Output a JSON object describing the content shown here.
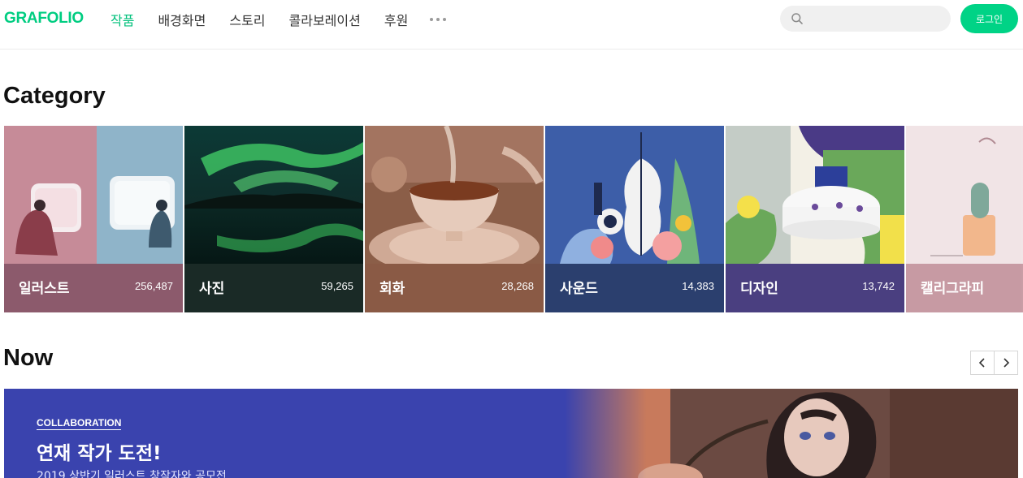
{
  "header": {
    "logo": "GRAFOLIO",
    "nav": [
      {
        "label": "작품",
        "active": true
      },
      {
        "label": "배경화면",
        "active": false
      },
      {
        "label": "스토리",
        "active": false
      },
      {
        "label": "콜라보레이션",
        "active": false
      },
      {
        "label": "후원",
        "active": false
      }
    ],
    "more_icon": "more-dots-icon",
    "search": {
      "placeholder": "",
      "value": "",
      "icon": "search-icon"
    },
    "login_label": "로그인"
  },
  "category": {
    "title": "Category",
    "cards": [
      {
        "name": "일러스트",
        "count": "256,487",
        "bar_color": "#8c5a6c"
      },
      {
        "name": "사진",
        "count": "59,265",
        "bar_color": "#1a2a26"
      },
      {
        "name": "회화",
        "count": "28,268",
        "bar_color": "#8a5a45"
      },
      {
        "name": "사운드",
        "count": "14,383",
        "bar_color": "#2b3f6e"
      },
      {
        "name": "디자인",
        "count": "13,742",
        "bar_color": "#4a3f80"
      },
      {
        "name": "캘리그라피",
        "count": "",
        "bar_color": "#c79aa3"
      }
    ]
  },
  "now": {
    "title": "Now",
    "prev_icon": "chevron-left-icon",
    "next_icon": "chevron-right-icon",
    "banner": {
      "tag": "COLLABORATION",
      "title": "연재 작가 도전!",
      "subtitle": "2019 상반기 일러스트 창작자와 공모전",
      "bg_color": "#3a43ae"
    }
  },
  "colors": {
    "brand": "#00cd81",
    "login": "#00d386"
  }
}
